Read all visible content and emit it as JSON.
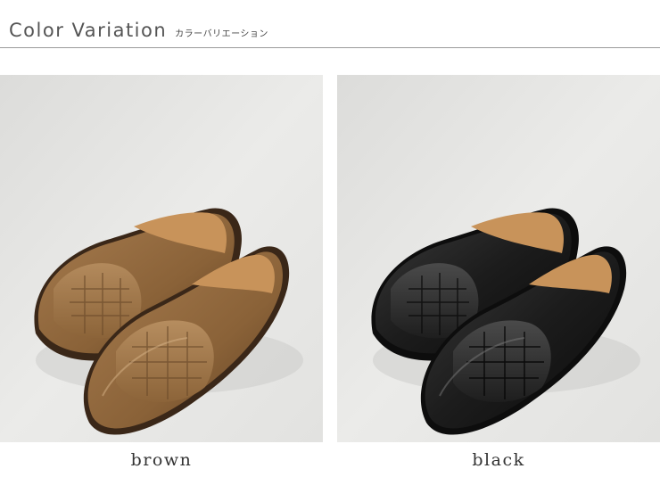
{
  "header": {
    "title": "Color Variation",
    "subtitle": "カラーバリエーション"
  },
  "variants": [
    {
      "label": "brown",
      "upper_color": "#8a6238",
      "sole_color": "#3a2718"
    },
    {
      "label": "black",
      "upper_color": "#1c1c1c",
      "sole_color": "#0d0d0d"
    }
  ],
  "colors": {
    "header_text": "#555555",
    "rule": "#9a9a9a",
    "photo_background": "#e8e8e6",
    "insole": "#c8935a"
  }
}
